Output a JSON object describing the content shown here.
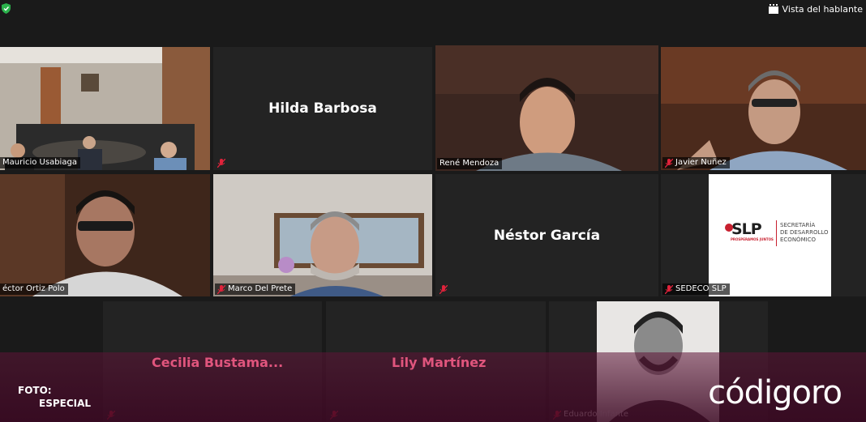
{
  "toolbar": {
    "view_label": "Vista del hablante"
  },
  "participants": [
    {
      "name": "Mauricio Usabiaga"
    },
    {
      "name": "Hilda Barbosa"
    },
    {
      "name": "René Mendoza"
    },
    {
      "name": "Javier Nuñez"
    },
    {
      "name": "éctor Ortiz Polo"
    },
    {
      "name": "Marco Del Prete"
    },
    {
      "name": "Néstor García"
    },
    {
      "name": "SEDECO SLP"
    },
    {
      "name": "Cecilia  Bustama..."
    },
    {
      "name": "Lily Martínez"
    },
    {
      "name": "Eduardo Infante"
    }
  ],
  "sedeco_logo": {
    "brand": "SLP",
    "tagline": "PROSPERAMOS JUNTOS",
    "line1": "SECRETARÍA",
    "line2": "DE DESARROLLO",
    "line3": "ECONÓMICO"
  },
  "credit": {
    "line1": "FOTO:",
    "line2": "ESPECIAL"
  },
  "watermark": "códigoro",
  "colors": {
    "active_border": "#c7df7a",
    "muted_red": "#e0233b",
    "pink_name": "#e0557d"
  },
  "icons": [
    "shield-icon",
    "speaker-view-icon",
    "muted-mic-icon"
  ]
}
